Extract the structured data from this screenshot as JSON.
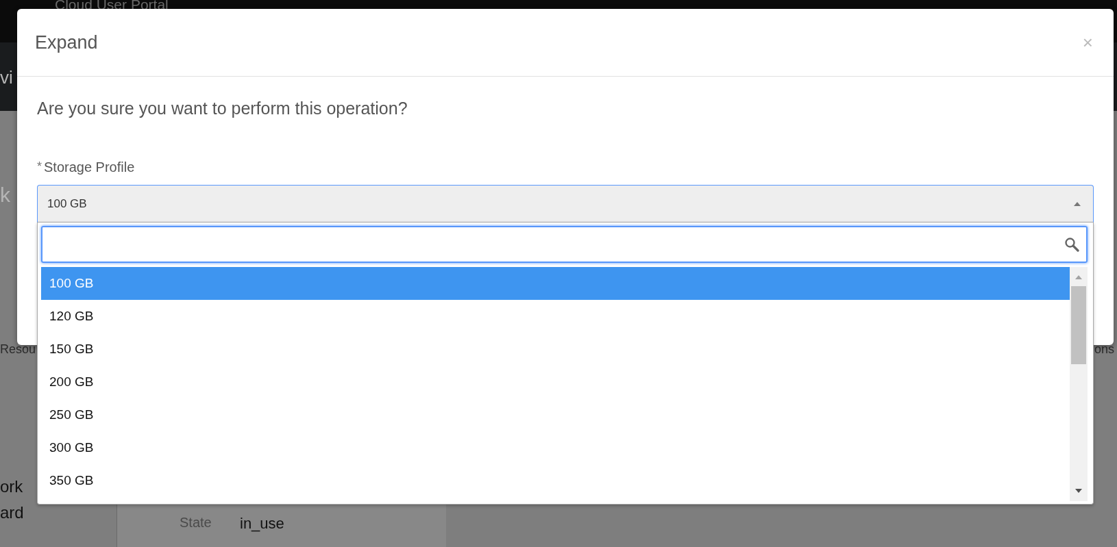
{
  "background": {
    "app_title": "Cloud User Portal",
    "fragments": [
      {
        "kind": "side",
        "text": "vi"
      },
      {
        "kind": "side",
        "text": "k"
      },
      {
        "kind": "tab",
        "text": "Resou"
      },
      {
        "kind": "tab-right",
        "text": "ons"
      },
      {
        "kind": "nav",
        "text": "ork"
      },
      {
        "kind": "nav",
        "text": "ard"
      },
      {
        "kind": "label",
        "text": "State"
      },
      {
        "kind": "value",
        "text": "in_use"
      }
    ]
  },
  "modal": {
    "title": "Expand",
    "close": "×",
    "question": "Are you sure you want to perform this operation?",
    "field": {
      "required_mark": "*",
      "label": "Storage Profile",
      "value": "100 GB",
      "expanded": true
    },
    "options": [
      {
        "label": "100 GB",
        "selected": true
      },
      {
        "label": "120 GB",
        "selected": false
      },
      {
        "label": "150 GB",
        "selected": false
      },
      {
        "label": "200 GB",
        "selected": false
      },
      {
        "label": "250 GB",
        "selected": false
      },
      {
        "label": "300 GB",
        "selected": false
      },
      {
        "label": "350 GB",
        "selected": false
      }
    ]
  }
}
